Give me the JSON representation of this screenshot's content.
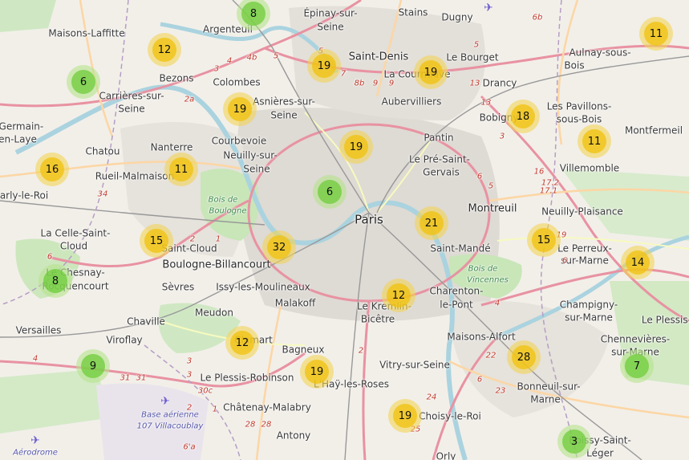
{
  "map": {
    "places": [
      {
        "text": "Épinay-sur-",
        "size": "n"
      },
      {
        "text": "Seine",
        "size": "n"
      },
      {
        "text": "Stains",
        "size": "n"
      },
      {
        "text": "Dugny",
        "size": "n"
      },
      {
        "text": "Maisons-Laffitte",
        "size": "n"
      },
      {
        "text": "Argenteuil",
        "size": "n"
      },
      {
        "text": "Saint-Denis",
        "size": "med"
      },
      {
        "text": "Le Bourget",
        "size": "n"
      },
      {
        "text": "Aulnay-sous-",
        "size": "n"
      },
      {
        "text": "Bois",
        "size": "n"
      },
      {
        "text": "Bezons",
        "size": "n"
      },
      {
        "text": "Colombes",
        "size": "n"
      },
      {
        "text": "La Courneuve",
        "size": "n"
      },
      {
        "text": "Drancy",
        "size": "n"
      },
      {
        "text": "Carrières-sur-",
        "size": "n"
      },
      {
        "text": "Seine",
        "size": "n"
      },
      {
        "text": "Asnières-sur-",
        "size": "n"
      },
      {
        "text": "Seine",
        "size": "n"
      },
      {
        "text": "Aubervilliers",
        "size": "n"
      },
      {
        "text": "Les Pavillons-",
        "size": "n"
      },
      {
        "text": "sous-Bois",
        "size": "n"
      },
      {
        "text": "Bobigny",
        "size": "n"
      },
      {
        "text": "-Germain-",
        "size": "n"
      },
      {
        "text": "en-Laye",
        "size": "n"
      },
      {
        "text": "Montfermeil",
        "size": "n"
      },
      {
        "text": "Chatou",
        "size": "n"
      },
      {
        "text": "Nanterre",
        "size": "n"
      },
      {
        "text": "Courbevoie",
        "size": "n"
      },
      {
        "text": "Pantin",
        "size": "n"
      },
      {
        "text": "Neuilly-sur-",
        "size": "n"
      },
      {
        "text": "Seine",
        "size": "n"
      },
      {
        "text": "Le Pré-Saint-",
        "size": "n"
      },
      {
        "text": "Gervais",
        "size": "n"
      },
      {
        "text": "Villemomble",
        "size": "n"
      },
      {
        "text": "Rueil-Malmaison",
        "size": "n"
      },
      {
        "text": "arly-le-Roi",
        "size": "n"
      },
      {
        "text": "Paris",
        "size": "big"
      },
      {
        "text": "Montreuil",
        "size": "med"
      },
      {
        "text": "Neuilly-Plaisance",
        "size": "n"
      },
      {
        "text": "La Celle-Saint-",
        "size": "n"
      },
      {
        "text": "Cloud",
        "size": "n"
      },
      {
        "text": "Saint-Cloud",
        "size": "n"
      },
      {
        "text": "Boulogne-Billancourt",
        "size": "med"
      },
      {
        "text": "Saint-Mandé",
        "size": "n"
      },
      {
        "text": "Le Perreux-",
        "size": "n"
      },
      {
        "text": "sur-Marne",
        "size": "n"
      },
      {
        "text": "Le Chesnay-",
        "size": "n"
      },
      {
        "text": "Rocquencourt",
        "size": "n"
      },
      {
        "text": "Sèvres",
        "size": "n"
      },
      {
        "text": "Issy-les-Moulineaux",
        "size": "n"
      },
      {
        "text": "Charenton-",
        "size": "n"
      },
      {
        "text": "le-Pont",
        "size": "n"
      },
      {
        "text": "Malakoff",
        "size": "n"
      },
      {
        "text": "Le Kremlin-",
        "size": "n"
      },
      {
        "text": "Bicêtre",
        "size": "n"
      },
      {
        "text": "Meudon",
        "size": "n"
      },
      {
        "text": "Champigny-",
        "size": "n"
      },
      {
        "text": "sur-Marne",
        "size": "n"
      },
      {
        "text": "Versailles",
        "size": "n"
      },
      {
        "text": "Chaville",
        "size": "n"
      },
      {
        "text": "Le Plessis-T",
        "size": "n"
      },
      {
        "text": "Maisons-Alfort",
        "size": "n"
      },
      {
        "text": "Viroflay",
        "size": "n"
      },
      {
        "text": "Clamart",
        "size": "n"
      },
      {
        "text": "Chennevières-",
        "size": "n"
      },
      {
        "text": "sur-Marne",
        "size": "n"
      },
      {
        "text": "Bagneux",
        "size": "n"
      },
      {
        "text": "Vitry-sur-Seine",
        "size": "n"
      },
      {
        "text": "Le Plessis-Robinson",
        "size": "n"
      },
      {
        "text": "L'Haÿ-les-Roses",
        "size": "n"
      },
      {
        "text": "Bonneuil-sur-",
        "size": "n"
      },
      {
        "text": "Marne",
        "size": "n"
      },
      {
        "text": "Châtenay-Malabry",
        "size": "n"
      },
      {
        "text": "Choisy-le-Roi",
        "size": "n"
      },
      {
        "text": "Antony",
        "size": "n"
      },
      {
        "text": "Boissy-Saint-",
        "size": "n"
      },
      {
        "text": "Léger",
        "size": "n"
      },
      {
        "text": "Orly",
        "size": "n"
      }
    ],
    "parks": [
      {
        "text": "Bois de"
      },
      {
        "text": "Boulogne"
      },
      {
        "text": "Bois de"
      },
      {
        "text": "Vincennes"
      }
    ],
    "airports": [
      {
        "text": "Base aérienne"
      },
      {
        "text": "107 Villacoublay"
      },
      {
        "text": "Aérodrome"
      }
    ],
    "road_numbers": [
      "4",
      "4b",
      "5",
      "5",
      "3",
      "2a",
      "7",
      "8b",
      "9",
      "9",
      "5",
      "13",
      "13",
      "6b",
      "3",
      "6",
      "5",
      "34",
      "16",
      "17.2",
      "17.1",
      "19",
      "2",
      "1",
      "6",
      "6",
      "3",
      "3",
      "2",
      "4",
      "22",
      "23",
      "24",
      "25",
      "6",
      "4",
      "31",
      "31",
      "30c",
      "2",
      "1",
      "28",
      "28",
      "6'a"
    ],
    "clusters": [
      {
        "count": "8",
        "level": "small"
      },
      {
        "count": "12",
        "level": "medium"
      },
      {
        "count": "6",
        "level": "small"
      },
      {
        "count": "19",
        "level": "medium"
      },
      {
        "count": "19",
        "level": "medium"
      },
      {
        "count": "11",
        "level": "medium"
      },
      {
        "count": "19",
        "level": "medium"
      },
      {
        "count": "18",
        "level": "medium"
      },
      {
        "count": "16",
        "level": "medium"
      },
      {
        "count": "11",
        "level": "medium"
      },
      {
        "count": "19",
        "level": "medium"
      },
      {
        "count": "11",
        "level": "medium"
      },
      {
        "count": "6",
        "level": "small"
      },
      {
        "count": "21",
        "level": "medium"
      },
      {
        "count": "15",
        "level": "medium"
      },
      {
        "count": "32",
        "level": "medium"
      },
      {
        "count": "15",
        "level": "medium"
      },
      {
        "count": "14",
        "level": "medium"
      },
      {
        "count": "8",
        "level": "small"
      },
      {
        "count": "12",
        "level": "medium"
      },
      {
        "count": "12",
        "level": "medium"
      },
      {
        "count": "28",
        "level": "medium"
      },
      {
        "count": "9",
        "level": "small"
      },
      {
        "count": "19",
        "level": "medium"
      },
      {
        "count": "7",
        "level": "small"
      },
      {
        "count": "19",
        "level": "medium"
      },
      {
        "count": "3",
        "level": "small"
      }
    ]
  }
}
